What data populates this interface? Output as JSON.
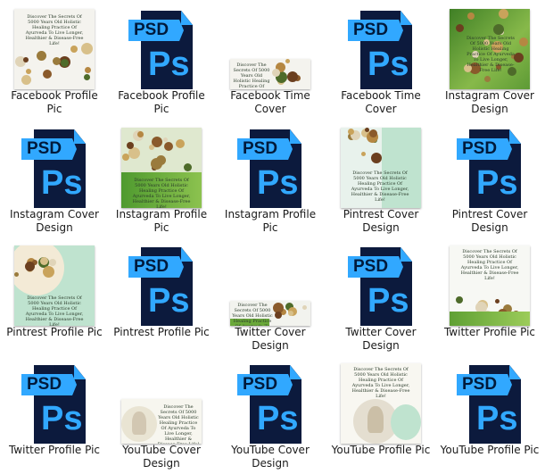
{
  "items": [
    {
      "label": "Facebook Profile Pic",
      "kind": "image",
      "variant": "fb-profile"
    },
    {
      "label": "Facebook Profile Pic",
      "kind": "psd",
      "badge": "PSD",
      "glyph": "Ps"
    },
    {
      "label": "Facebook Time Cover",
      "kind": "image",
      "variant": "fb-cover"
    },
    {
      "label": "Facebook Time Cover",
      "kind": "psd",
      "badge": "PSD",
      "glyph": "Ps"
    },
    {
      "label": "Instagram Cover Design",
      "kind": "image",
      "variant": "ig-cover"
    },
    {
      "label": "Instagram Cover Design",
      "kind": "psd",
      "badge": "PSD",
      "glyph": "Ps"
    },
    {
      "label": "Instagram Profile Pic",
      "kind": "image",
      "variant": "ig-profile"
    },
    {
      "label": "Instagram Profile Pic",
      "kind": "psd",
      "badge": "PSD",
      "glyph": "Ps"
    },
    {
      "label": "Pintrest Cover Design",
      "kind": "image",
      "variant": "pin-cover"
    },
    {
      "label": "Pintrest Cover Design",
      "kind": "psd",
      "badge": "PSD",
      "glyph": "Ps"
    },
    {
      "label": "Pintrest Profile Pic",
      "kind": "image",
      "variant": "pin-profile"
    },
    {
      "label": "Pintrest Profile Pic",
      "kind": "psd",
      "badge": "PSD",
      "glyph": "Ps"
    },
    {
      "label": "Twitter Cover Design",
      "kind": "image",
      "variant": "tw-cover"
    },
    {
      "label": "Twitter Cover Design",
      "kind": "psd",
      "badge": "PSD",
      "glyph": "Ps"
    },
    {
      "label": "Twitter Profile Pic",
      "kind": "image",
      "variant": "tw-profile"
    },
    {
      "label": "Twitter Profile Pic",
      "kind": "psd",
      "badge": "PSD",
      "glyph": "Ps"
    },
    {
      "label": "YouTube Cover Design",
      "kind": "image",
      "variant": "yt-cover"
    },
    {
      "label": "YouTube Cover Design",
      "kind": "psd",
      "badge": "PSD",
      "glyph": "Ps"
    },
    {
      "label": "YouTube Profile Pic",
      "kind": "image",
      "variant": "yt-profile"
    },
    {
      "label": "YouTube Profile Pic",
      "kind": "psd",
      "badge": "PSD",
      "glyph": "Ps"
    }
  ],
  "thumb_text": {
    "headline": "Discover The Secrets Of 5000 Years Old Holistic Healing Practice Of Ayurveda To Live Longer, Healthier & Disease-Free Life!"
  },
  "colors": {
    "psd_dark": "#0c1a3d",
    "psd_blue": "#31a8ff",
    "leaf_green": "#4f9a2f",
    "mint": "#bfe3cf"
  }
}
